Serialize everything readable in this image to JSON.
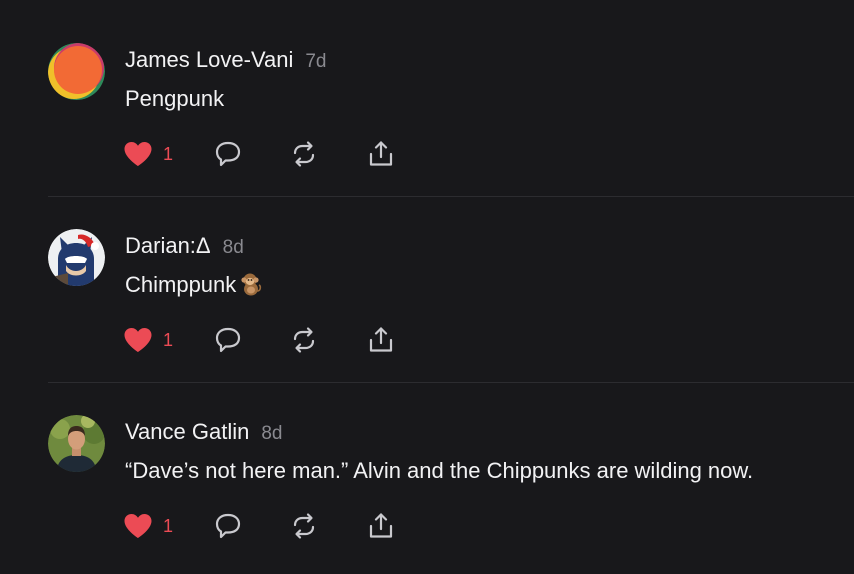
{
  "theme": {
    "background": "#18181b",
    "text": "#f2f2f4",
    "muted": "#8a8a90",
    "like_color": "#ec4b55",
    "icon_color": "#c9c9ce"
  },
  "posts": [
    {
      "author": "James Love-Vani",
      "time": "7d",
      "text": "Pengpunk",
      "likes": "1",
      "liked": true,
      "avatar_icon": "orange-circle-avatar"
    },
    {
      "author": "Darian:Δ",
      "time": "8d",
      "text": "Chimppunk",
      "text_emoji_icon": "monkey-emoji-icon",
      "likes": "1",
      "liked": true,
      "avatar_icon": "batman-santa-avatar"
    },
    {
      "author": "Vance Gatlin",
      "time": "8d",
      "text": "“Dave’s not here man.” Alvin and the Chippunks are wilding now.",
      "likes": "1",
      "liked": true,
      "avatar_icon": "person-photo-avatar"
    }
  ]
}
